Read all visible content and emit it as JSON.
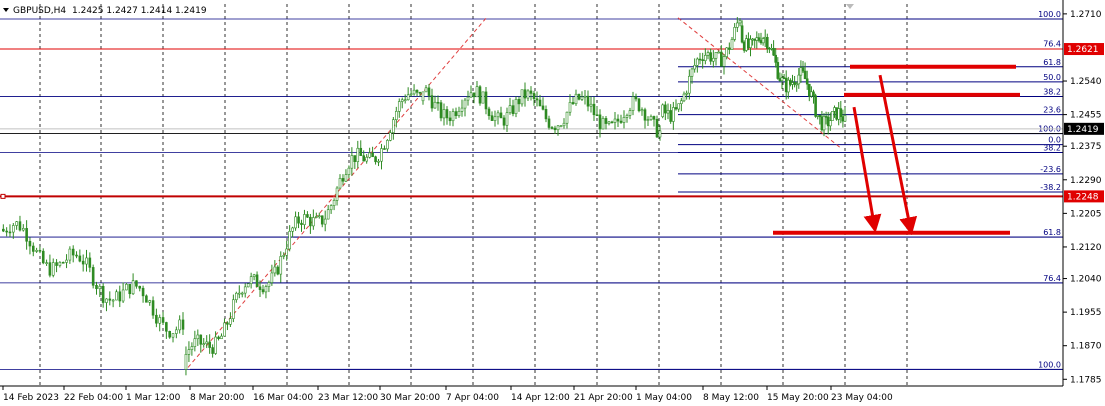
{
  "chart_data": {
    "type": "candlestick",
    "symbol": "GBPUSD,H4",
    "ohlc": [
      "1.2425",
      "1.2427",
      "1.2414",
      "1.2419"
    ],
    "y_axis": {
      "ylim": [
        1.1768,
        1.2735
      ],
      "ticks": [
        "1.2710",
        "1.2540",
        "1.2455",
        "1.2375",
        "1.2290",
        "1.2205",
        "1.2120",
        "1.2040",
        "1.1955",
        "1.1870",
        "1.1785"
      ]
    },
    "x_axis": {
      "labels": [
        "14 Feb 2023",
        "22 Feb 04:00",
        "1 Mar 12:00",
        "8 Mar 20:00",
        "16 Mar 04:00",
        "23 Mar 12:00",
        "30 Mar 20:00",
        "7 Apr 04:00",
        "14 Apr 12:00",
        "21 Apr 20:00",
        "1 May 04:00",
        "8 May 12:00",
        "15 May 20:00",
        "23 May 04:00"
      ]
    },
    "price_badges": [
      {
        "label": "1.2621",
        "price": 1.2621,
        "color": "#e00000"
      },
      {
        "label": "1.2419",
        "price": 1.2419,
        "color": "#000000"
      },
      {
        "label": "1.2248",
        "price": 1.2248,
        "color": "#e00000"
      }
    ],
    "fib_levels": [
      {
        "label": "100.0",
        "price": 1.2697
      },
      {
        "label": "76.4",
        "price": 1.2622
      },
      {
        "label": "61.8",
        "price": 1.2576
      },
      {
        "label": "50.0",
        "price": 1.2538
      },
      {
        "label": "38.2",
        "price": 1.2501
      },
      {
        "label": "23.6",
        "price": 1.2455
      },
      {
        "label": "100.0",
        "price": 1.2407
      },
      {
        "label": "0.0",
        "price": 1.2379
      },
      {
        "label": "38.2",
        "price": 1.2359
      },
      {
        "label": "-23.6",
        "price": 1.2305
      },
      {
        "label": "-38.2",
        "price": 1.2259
      },
      {
        "label": "61.8",
        "price": 1.2145
      },
      {
        "label": "76.4",
        "price": 1.2029
      },
      {
        "label": "100.0",
        "price": 1.181
      }
    ],
    "series": [
      {
        "segment": "feb",
        "from": 1.2165,
        "to": 1.1925,
        "points": 55
      },
      {
        "segment": "rally",
        "from": 1.181,
        "to": 1.2512,
        "points": 80
      },
      {
        "segment": "apr",
        "from": 1.249,
        "to": 1.2445,
        "points": 80
      },
      {
        "segment": "may-up",
        "from": 1.245,
        "to": 1.2685,
        "points": 30
      },
      {
        "segment": "may-down",
        "from": 1.268,
        "to": 1.241,
        "points": 50
      }
    ]
  }
}
